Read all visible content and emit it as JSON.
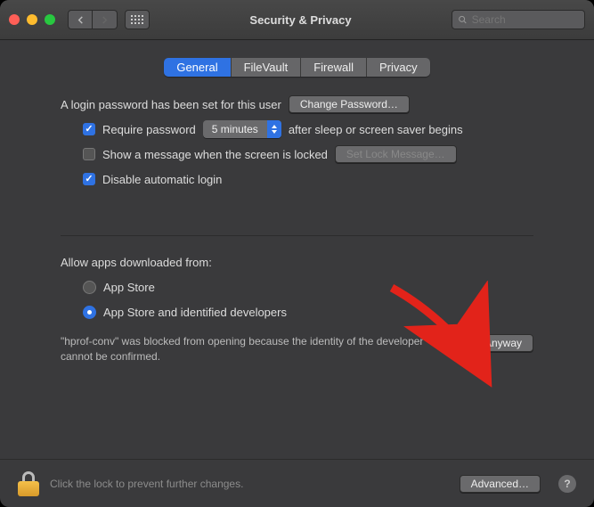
{
  "window": {
    "title": "Security & Privacy"
  },
  "search": {
    "placeholder": "Search"
  },
  "tabs": {
    "general": "General",
    "filevault": "FileVault",
    "firewall": "Firewall",
    "privacy": "Privacy"
  },
  "general": {
    "password_set": "A login password has been set for this user",
    "change_password": "Change Password…",
    "require_password": "Require password",
    "delay_option": "5 minutes",
    "after_sleep": "after sleep or screen saver begins",
    "show_message": "Show a message when the screen is locked",
    "set_lock_message": "Set Lock Message…",
    "disable_auto_login": "Disable automatic login"
  },
  "gatekeeper": {
    "heading": "Allow apps downloaded from:",
    "option_appstore": "App Store",
    "option_identified": "App Store and identified developers",
    "blocked_message": "\"hprof-conv\" was blocked from opening because the identity of the developer cannot be confirmed.",
    "open_anyway": "Open Anyway"
  },
  "footer": {
    "lock_text": "Click the lock to prevent further changes.",
    "advanced": "Advanced…",
    "help": "?"
  }
}
